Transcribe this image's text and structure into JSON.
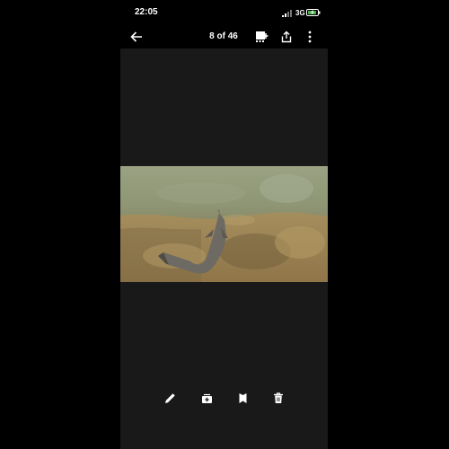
{
  "status_bar": {
    "time": "22:05",
    "network": "3G",
    "signal_icon": "cellular-signal-icon",
    "battery_icon": "battery-charging-icon"
  },
  "top_bar": {
    "back_icon": "arrow-left-icon",
    "counter": "8 of 46",
    "cast_icon": "cast-icon",
    "share_icon": "share-icon",
    "more_icon": "more-vert-icon"
  },
  "photo": {
    "description_icon": "underwater-catfish-photo"
  },
  "bottom_bar": {
    "edit_icon": "pencil-icon",
    "add_to_album_icon": "add-to-album-icon",
    "lens_icon": "bookmark-icon",
    "delete_icon": "trash-icon"
  },
  "colors": {
    "background": "#000000",
    "viewer_background": "#191919",
    "icon": "#ffffff",
    "battery_fill": "#4caf50"
  }
}
